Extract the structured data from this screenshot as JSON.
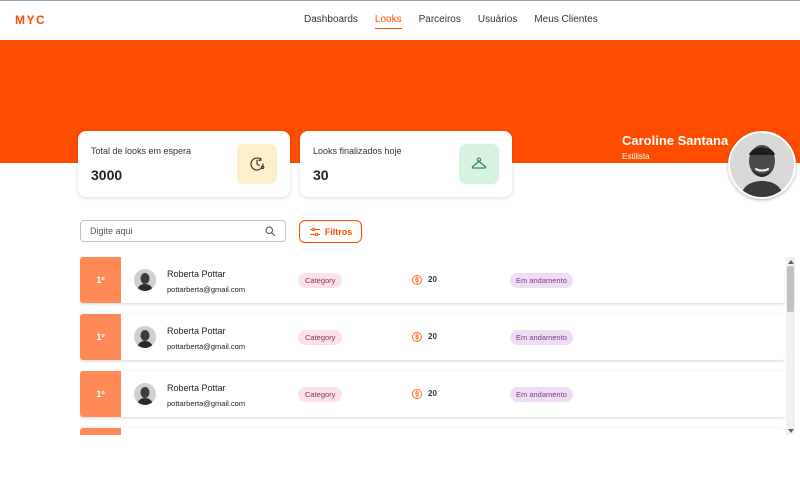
{
  "app": {
    "logo": "MYC"
  },
  "nav": {
    "items": [
      "Dashboards",
      "Looks",
      "Parceiros",
      "Usuários",
      "Meus Clientes"
    ],
    "active_index": 1
  },
  "colors": {
    "brand": "#ff4d00",
    "rank_bg": "#ff8a57",
    "clock_card_icon_bg": "#fdefc9",
    "hanger_card_icon_bg": "#d6f3e1",
    "category_tag_bg": "#fbe1ec",
    "status_tag_bg": "#f0dcf4"
  },
  "stats": [
    {
      "label": "Total de looks em espera",
      "value": "3000",
      "icon": "clock-icon"
    },
    {
      "label": "Looks finalizados hoje",
      "value": "30",
      "icon": "hanger-icon"
    }
  ],
  "profile": {
    "name": "Caroline Santana",
    "role": "Estilista"
  },
  "search": {
    "placeholder": "Digite aqui",
    "value": ""
  },
  "filter": {
    "label": "Filtros"
  },
  "list": {
    "rows": [
      {
        "rank": "1º",
        "name": "Roberta Pottar",
        "email": "pottarberta@gmail.com",
        "category": "Category",
        "coins": "20",
        "status": "Em andamento"
      },
      {
        "rank": "1º",
        "name": "Roberta Pottar",
        "email": "pottarberta@gmail.com",
        "category": "Category",
        "coins": "20",
        "status": "Em andamento"
      },
      {
        "rank": "1º",
        "name": "Roberta Pottar",
        "email": "pottarberta@gmail.com",
        "category": "Category",
        "coins": "20",
        "status": "Em andamento"
      },
      {
        "rank": "",
        "name": "",
        "email": "",
        "category": "",
        "coins": "",
        "status": ""
      }
    ]
  }
}
